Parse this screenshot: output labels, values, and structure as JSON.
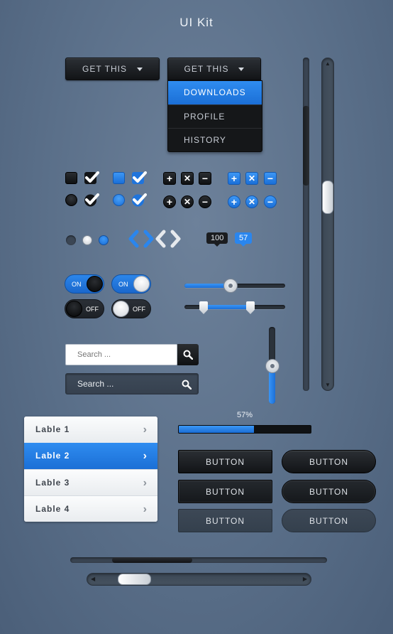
{
  "title": "UI Kit",
  "dropdown1": {
    "label": "GET THIS"
  },
  "dropdown2": {
    "label": "GET THIS",
    "items": [
      "DOWNLOADS",
      "PROFILE",
      "HISTORY"
    ],
    "selected": 0
  },
  "badges": {
    "dark": "100",
    "blue": "57"
  },
  "toggles": [
    {
      "label": "ON",
      "state": "on",
      "knob": "black"
    },
    {
      "label": "ON",
      "state": "on",
      "knob": "white"
    },
    {
      "label": "OFF",
      "state": "off",
      "knob": "black"
    },
    {
      "label": "OFF",
      "state": "off",
      "knob": "white"
    }
  ],
  "slider_single": {
    "value_fraction": 0.46
  },
  "slider_range": {
    "low_fraction": 0.19,
    "high_fraction": 0.65
  },
  "slider_vertical": {
    "value_fraction": 0.5
  },
  "search1": {
    "placeholder": "Search ..."
  },
  "search2": {
    "placeholder": "Search ..."
  },
  "list": {
    "items": [
      "Lable 1",
      "Lable 2",
      "Lable 3",
      "Lable 4"
    ],
    "selected": 1
  },
  "progress": {
    "label": "57%",
    "value": 0.57
  },
  "buttons": {
    "label": "BUTTON"
  },
  "colors": {
    "accent": "#1b6fd6",
    "dark": "#121417",
    "background": "#5a6f89"
  },
  "icons": [
    "plus-icon",
    "times-icon",
    "minus-icon",
    "check-icon",
    "chevron-left-icon",
    "chevron-right-icon",
    "search-icon"
  ]
}
